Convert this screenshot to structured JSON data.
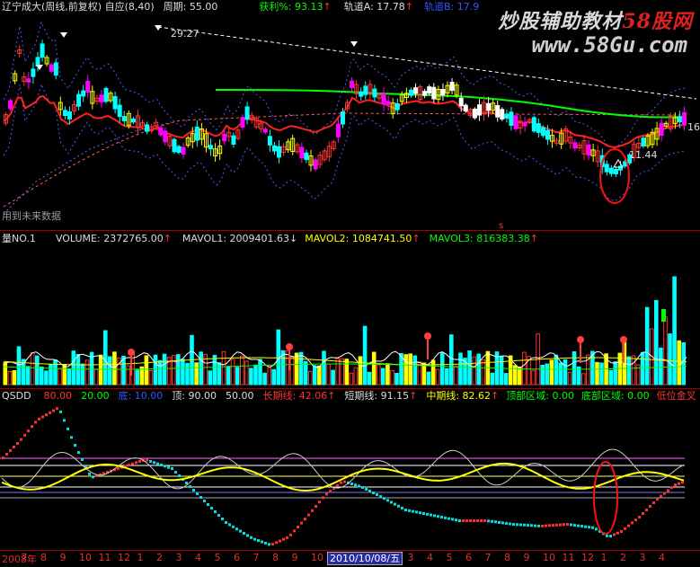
{
  "price_header": {
    "title": "辽宁成大(周线,前复权) 自应(8,40)",
    "period_label": "周期: 55.00",
    "profit_label": "获利%: 93.13",
    "rail_a_label": "轨道A: 17.78",
    "rail_b_label": "轨道B: 17.9"
  },
  "price_annotations": {
    "high": "29.27",
    "low": "11.44",
    "right_value": "16",
    "future_note": "用到未来数据"
  },
  "volume_header": {
    "title": "量NO.1",
    "volume": "VOLUME: 2372765.00",
    "mavol1": "MAVOL1: 2009401.63",
    "mavol2": "MAVOL2: 1084741.50",
    "mavol3": "MAVOL3: 816383.38"
  },
  "qsdd_header": {
    "title": "QSDD",
    "v80": "80.00",
    "v20": "20.00",
    "bottom": "底: 10.00",
    "top": "顶: 90.00",
    "mid": "50.00",
    "long_line": "长期线: 42.06",
    "short_line": "短期线: 91.15",
    "mid_line": "中期线: 82.62",
    "top_zone": "顶部区域: 0.00",
    "bottom_zone": "底部区域: 0.00",
    "position": "低位金叉"
  },
  "watermark": {
    "line1_a": "炒股辅助教材",
    "line1_b": "58股网",
    "line2": "www.58Gu.com"
  },
  "axis": {
    "ticks": [
      "2008年",
      "7",
      "8",
      "9",
      "10",
      "11",
      "12",
      "1",
      "2",
      "3",
      "4",
      "5",
      "6",
      "7",
      "8",
      "9",
      "10",
      "11",
      "12",
      "1",
      "2",
      "3",
      "4",
      "5",
      "6",
      "7",
      "8",
      "9",
      "10",
      "11",
      "12",
      "1",
      "2",
      "3",
      "4"
    ],
    "selected_date": "2010/10/08/五"
  },
  "colors": {
    "up": "#ff3333",
    "down": "#00ffff",
    "ma_red": "#ff2020",
    "ma_green": "#00ff00",
    "ma_blue": "#2020ff",
    "yellow": "#ffff00",
    "magenta": "#ff00ff"
  }
}
